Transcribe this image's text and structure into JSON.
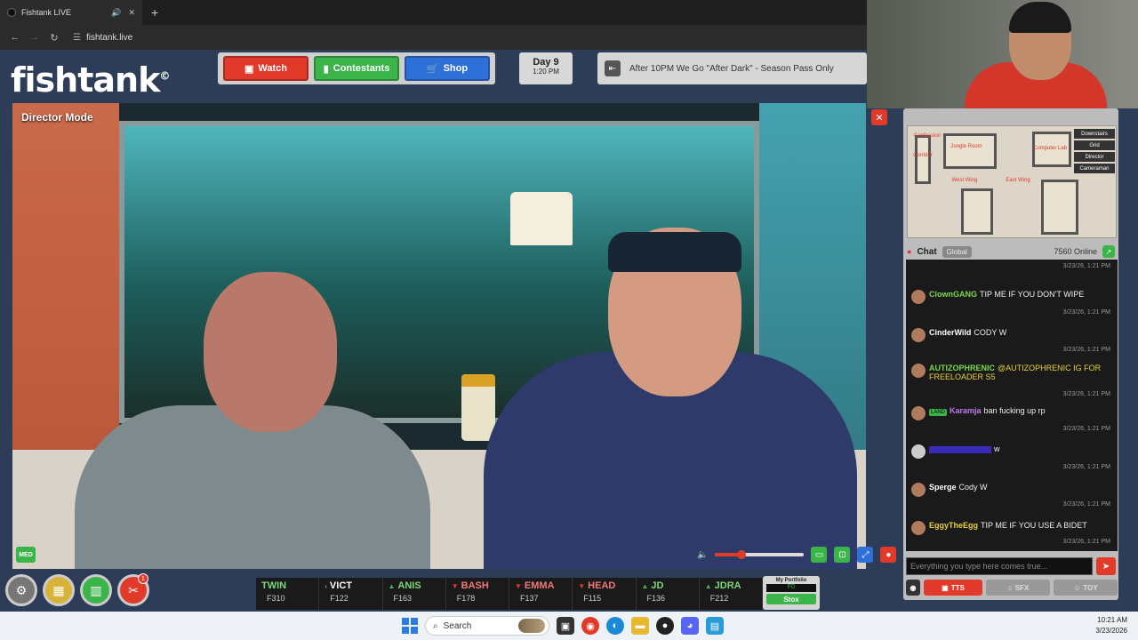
{
  "browser": {
    "tab_title": "Fishtank LIVE",
    "url": "fishtank.live"
  },
  "site": {
    "logo": "fishtank",
    "logo_mark": "©"
  },
  "nav": {
    "watch": "Watch",
    "contestants": "Contestants",
    "shop": "Shop"
  },
  "day": {
    "label": "Day 9",
    "time": "1:20 PM"
  },
  "banner": "After 10PM We Go \"After Dark\" - Season Pass Only",
  "video": {
    "mode_label": "Director Mode",
    "quality_badge": "MED",
    "volume_level": 0.3
  },
  "map": {
    "rooms": [
      "Confession",
      "Corridor",
      "Jungle Room",
      "Computer Lab",
      "West Wing",
      "East Wing"
    ],
    "menu": [
      "Downstairs",
      "Grid",
      "Director",
      "Cameraman"
    ]
  },
  "chat": {
    "title": "Chat",
    "channel": "Global",
    "online": "7560 Online",
    "input_placeholder": "Everything you type here comes true...",
    "buttons": {
      "tts": "TTS",
      "sfx": "SFX",
      "toy": "TOY"
    },
    "messages": [
      {
        "user": "ClownGANG",
        "user_color": "#7ad84a",
        "text": "TIP ME IF YOU DON'T WIPE",
        "time": "3/23/26, 1:21 PM",
        "badge": ""
      },
      {
        "user": "CinderWild",
        "user_color": "#ffffff",
        "text": "CODY W",
        "time": "3/23/26, 1:21 PM",
        "badge": ""
      },
      {
        "user": "AUTIZOPHRENIC",
        "user_color": "#7ad84a",
        "text": "@AUTIZOPHRENIC IG FOR FREELOADER S5",
        "time": "3/23/26, 1:21 PM",
        "badge": ""
      },
      {
        "user": "Karamja",
        "user_color": "#c07af0",
        "text": "ban fucking up rp",
        "time": "3/23/26, 1:21 PM",
        "badge": "LAND"
      },
      {
        "user": "",
        "user_color": "#5a4ad8",
        "text": "w",
        "time": "3/23/26, 1:21 PM",
        "badge": ""
      },
      {
        "user": "Sperge",
        "user_color": "#ffffff",
        "text": "Cody W",
        "time": "3/23/26, 1:21 PM",
        "badge": ""
      },
      {
        "user": "EggyTheEgg",
        "user_color": "#e8d23a",
        "text": "TIP ME IF YOU USE A BIDET",
        "time": "3/23/26, 1:21 PM",
        "badge": ""
      }
    ]
  },
  "ticker": [
    {
      "name": "TWIN",
      "value": "F310",
      "trend": "none",
      "color": "green"
    },
    {
      "name": "VICT",
      "value": "F122",
      "trend": "none",
      "color": "white"
    },
    {
      "name": "ANIS",
      "value": "F163",
      "trend": "up",
      "color": "green"
    },
    {
      "name": "BASH",
      "value": "F178",
      "trend": "down",
      "color": "red"
    },
    {
      "name": "EMMA",
      "value": "F137",
      "trend": "down",
      "color": "red"
    },
    {
      "name": "HEAD",
      "value": "F115",
      "trend": "down",
      "color": "red"
    },
    {
      "name": "JD",
      "value": "F136",
      "trend": "up",
      "color": "green"
    },
    {
      "name": "JDRA",
      "value": "F212",
      "trend": "up",
      "color": "green"
    }
  ],
  "portfolio": {
    "label": "My Portfolio",
    "value": "F0",
    "button": "Stox"
  },
  "notifications": "1",
  "taskbar": {
    "search": "Search",
    "time": "10:21 AM",
    "date": "3/23/2026"
  },
  "colors": {
    "accent_red": "#e23a2a",
    "accent_green": "#3bb54a",
    "accent_blue": "#2f6fd8"
  }
}
